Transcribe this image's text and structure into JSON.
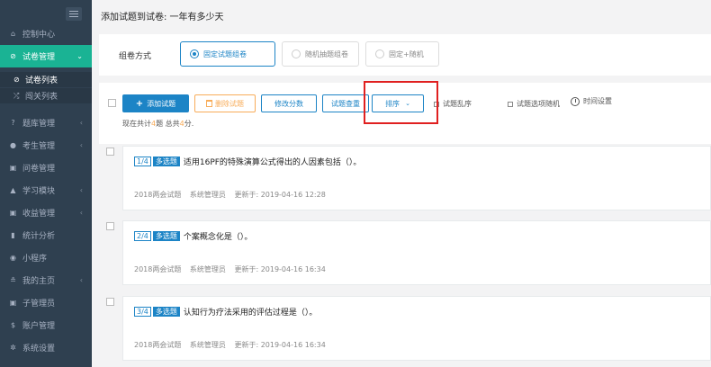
{
  "sidebar": {
    "items": [
      {
        "icon": "home-icon",
        "glyph": "⌂",
        "label": "控制中心"
      },
      {
        "icon": "check-circle-icon",
        "glyph": "⊘",
        "label": "试卷管理"
      },
      {
        "icon": "help-circle-icon",
        "glyph": "?",
        "label": "题库管理"
      },
      {
        "icon": "user-icon",
        "glyph": "●",
        "label": "考生管理"
      },
      {
        "icon": "survey-icon",
        "glyph": "▣",
        "label": "问卷管理"
      },
      {
        "icon": "graduation-icon",
        "glyph": "▲",
        "label": "学习模块"
      },
      {
        "icon": "revenue-icon",
        "glyph": "▣",
        "label": "收益管理"
      },
      {
        "icon": "bar-chart-icon",
        "glyph": "▮",
        "label": "统计分析"
      },
      {
        "icon": "chat-icon",
        "glyph": "◉",
        "label": "小程序"
      },
      {
        "icon": "home-page-icon",
        "glyph": "≗",
        "label": "我的主页"
      },
      {
        "icon": "sub-admin-icon",
        "glyph": "▣",
        "label": "子管理员"
      },
      {
        "icon": "dollar-icon",
        "glyph": "$",
        "label": "账户管理"
      },
      {
        "icon": "gear-icon",
        "glyph": "✲",
        "label": "系统设置"
      }
    ],
    "sub_items": [
      {
        "icon": "check-circle-icon",
        "glyph": "⊘",
        "label": "试卷列表"
      },
      {
        "icon": "shuffle-icon",
        "glyph": "⤮",
        "label": "闯关列表"
      }
    ]
  },
  "page": {
    "title": "添加试题到试卷: 一年有多少天"
  },
  "mode": {
    "label": "组卷方式",
    "options": [
      "固定试题组卷",
      "随机抽题组卷",
      "固定+随机"
    ],
    "selected": "固定试题组卷"
  },
  "toolbar": {
    "add": "添加试题",
    "delete": "删除试题",
    "modify_score": "修改分数",
    "dedupe": "试题查重",
    "sort": "排序",
    "shuffle_questions": "试题乱序",
    "shuffle_options": "试题选项随机",
    "time_settings": "时间设置"
  },
  "summary": {
    "prefix": "现在共计",
    "count": "4",
    "mid": "题 总共",
    "score": "4",
    "suffix": "分."
  },
  "questions": [
    {
      "index": "1/4",
      "type": "多选题",
      "text": "适用16PF的特殊演算公式得出的人因素包括（）。",
      "bank": "2018两会试题",
      "author": "系统管理员",
      "updated": "更新于: 2019-04-16 12:28"
    },
    {
      "index": "2/4",
      "type": "多选题",
      "text": "个案概念化是（）。",
      "bank": "2018两会试题",
      "author": "系统管理员",
      "updated": "更新于: 2019-04-16 16:34"
    },
    {
      "index": "3/4",
      "type": "多选题",
      "text": "认知行为疗法采用的评估过程是（）。",
      "bank": "2018两会试题",
      "author": "系统管理员",
      "updated": "更新于: 2019-04-16 16:34"
    }
  ],
  "colors": {
    "sidebar_bg": "#2f4050",
    "active_green": "#1ab394",
    "primary_blue": "#1c84c6",
    "warning_orange": "#f8ac59",
    "highlight_red": "#e02020"
  }
}
